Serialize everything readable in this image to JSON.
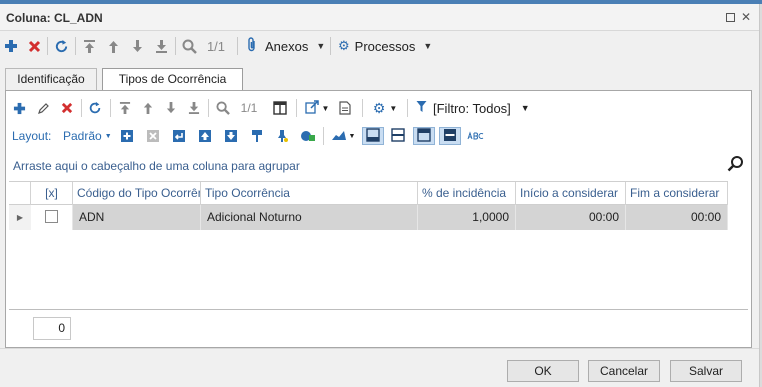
{
  "window": {
    "title": "Coluna: CL_ADN"
  },
  "toolbar_main": {
    "pager": "1/1",
    "anexos_label": "Anexos",
    "processos_label": "Processos"
  },
  "tabs": [
    {
      "label": "Identificação"
    },
    {
      "label": "Tipos de Ocorrência"
    }
  ],
  "panel_toolbar": {
    "pager": "1/1",
    "filter_label": "[Filtro: Todos]",
    "layout_label": "Layout:",
    "layout_value": "Padrão"
  },
  "group_bar": {
    "text": "Arraste aqui o cabeçalho de uma coluna para agrupar"
  },
  "grid": {
    "columns": [
      "[x]",
      "Código do Tipo Ocorrên...",
      "Tipo Ocorrência",
      "% de incidência",
      "Início a considerar",
      "Fim a considerar"
    ],
    "rows": [
      {
        "codigo": "ADN",
        "tipo": "Adicional Noturno",
        "incidencia": "1,0000",
        "inicio": "00:00",
        "fim": "00:00"
      }
    ]
  },
  "record_count": "0",
  "buttons": {
    "ok": "OK",
    "cancel": "Cancelar",
    "save": "Salvar"
  },
  "colors": {
    "accent_blue": "#2b6cb0",
    "delete_red": "#d32f2f",
    "header_text": "#3a5f8f"
  }
}
